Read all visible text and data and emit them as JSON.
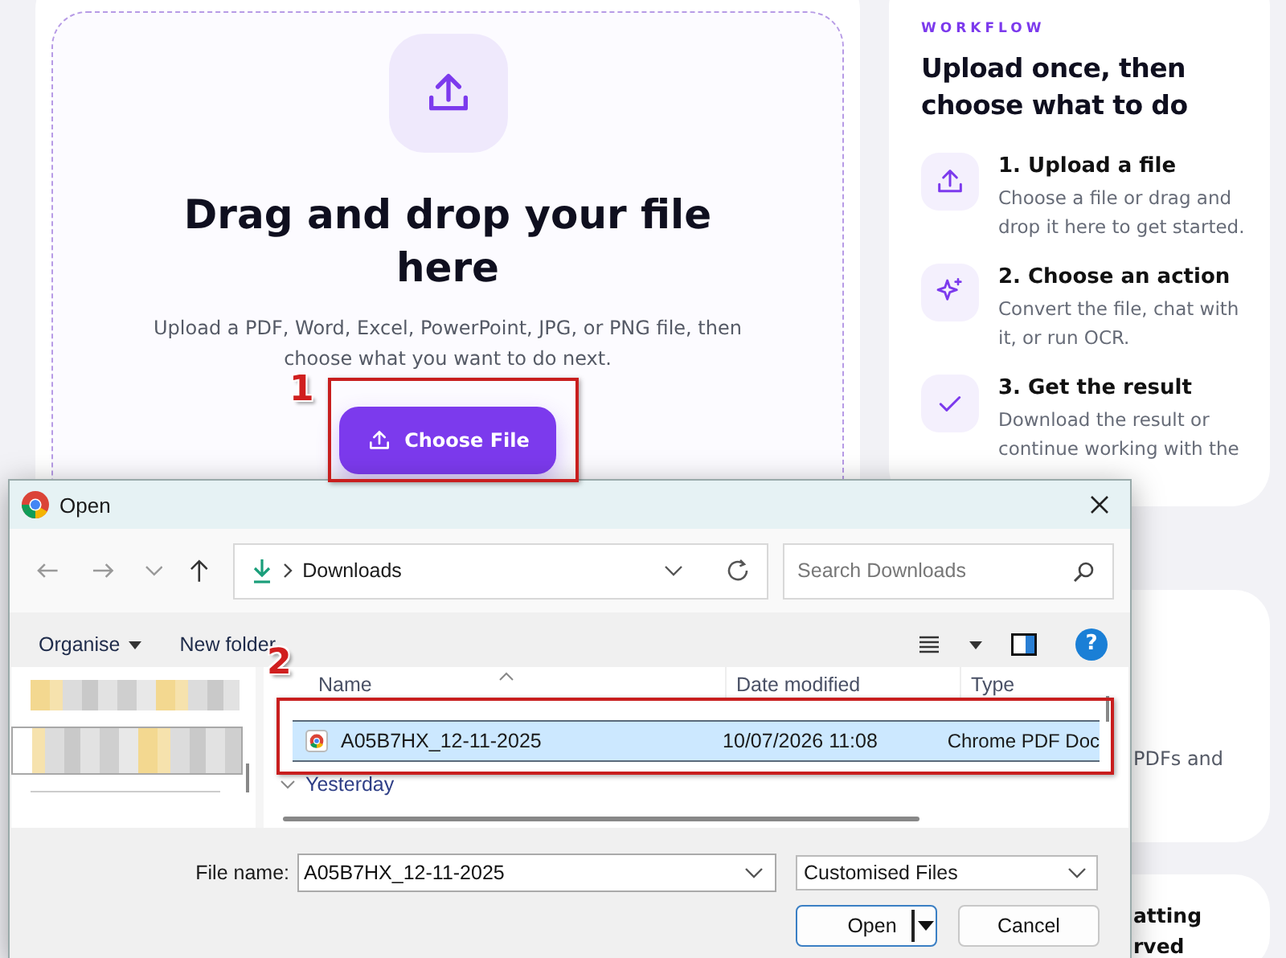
{
  "upload_card": {
    "title": "Drag and drop your file here",
    "description": "Upload a PDF, Word, Excel, PowerPoint, JPG, or PNG file, then choose what you want to do next.",
    "button": "Choose File"
  },
  "workflow_card": {
    "eyebrow": "WORKFLOW",
    "title": "Upload once, then choose what to do",
    "steps": [
      {
        "kind": "upload",
        "title": "1. Upload a file",
        "text": "Choose a file or drag and drop it here to get started."
      },
      {
        "kind": "sparkle",
        "title": "2. Choose an action",
        "text": "Convert the file, chat with it, or run OCR."
      },
      {
        "kind": "check",
        "title": "3. Get the result",
        "text": "Download the result or continue working with the"
      }
    ]
  },
  "side_cards": [
    {
      "kind": "text",
      "lines": [
        "PDFs and"
      ]
    },
    {
      "kind": "heading",
      "lines": [
        "atting",
        "rved"
      ]
    }
  ],
  "dialog": {
    "title": "Open",
    "path": "Downloads",
    "help": "?",
    "search": {
      "placeholder": "Search Downloads"
    },
    "toolbar": [
      "Organise",
      "New folder"
    ],
    "nav_items": [
      {
        "selected": false
      },
      {
        "selected": true
      }
    ],
    "columns": [
      "Name",
      "Date modified",
      "Type"
    ],
    "rows": [
      {
        "name": "A05B7HX_12-11-2025",
        "date": "10/07/2026 11:08",
        "type": "Chrome PDF Doc",
        "selected": true
      }
    ],
    "groups": [
      {
        "label": "Yesterday",
        "expanded": true
      }
    ],
    "file_name_label": "File name:",
    "file_name": "A05B7HX_12-11-2025",
    "file_type": "Customised Files",
    "buttons": [
      {
        "label": "Open",
        "kind": "split"
      },
      {
        "label": "Cancel",
        "kind": "plain"
      }
    ]
  },
  "annotations": [
    {
      "label": "1"
    },
    {
      "label": "2"
    }
  ]
}
